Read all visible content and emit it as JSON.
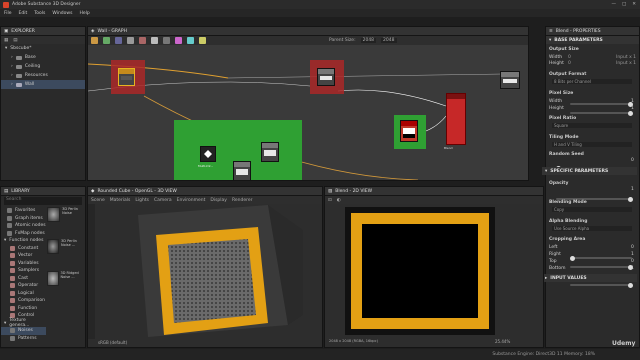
{
  "app": {
    "title": "Adobe Substance 3D Designer",
    "window_buttons": [
      "—",
      "□",
      "✕"
    ]
  },
  "menu": [
    "File",
    "Edit",
    "Tools",
    "Windows",
    "Help"
  ],
  "explorer": {
    "title": "EXPLORER",
    "root": "Sbscube*",
    "items": [
      "Base",
      "Ceiling",
      "Resources",
      "Wall"
    ],
    "selected": "Wall"
  },
  "graph": {
    "title": "Wall - GRAPH",
    "parent_size_label": "Parent Size:",
    "parent_size_w": "2048",
    "parent_size_h": "2048",
    "nodes": {
      "uniform": "Uniform Co...",
      "blend": "Blend",
      "shape": "Shape",
      "mask_label": "Multi-Dir..."
    }
  },
  "library": {
    "title": "LIBRARY",
    "search_placeholder": "Search",
    "tree": [
      "Favorites",
      "Graph items",
      "Atomic nodes",
      "FxMap nodes",
      "Function nodes",
      "Constant",
      "Vector",
      "Variables",
      "Samplers",
      "Cast",
      "Operator",
      "Logical",
      "Comparison",
      "Function",
      "Control",
      "Texture genera...",
      "Noises",
      "Patterns"
    ],
    "thumbs": [
      "3D Perlin Noise",
      "3D Perlin Noise ...",
      "3D Ridged Noise ..."
    ]
  },
  "view3d": {
    "title": "Rounded Cube - OpenGL - 3D VIEW",
    "menu": [
      "Scene",
      "Materials",
      "Lights",
      "Camera",
      "Environment",
      "Display",
      "Renderer"
    ],
    "status": "sRGB (default)"
  },
  "view2d": {
    "title": "Blend - 2D VIEW",
    "status": "2048 x 2048 (RGBA, 16bpc)",
    "zoom": "25.44%"
  },
  "properties": {
    "title": "Blend - PROPERTIES",
    "sections": {
      "base": "BASE PARAMETERS",
      "specific": "SPECIFIC PARAMETERS",
      "input": "INPUT VALUES"
    },
    "output_size": "Output Size",
    "width": "Width",
    "height": "Height",
    "relative": "Relative to parent",
    "w_val": "0",
    "h_val": "0",
    "input_1": "Input x 1",
    "output_format": "Output Format",
    "format_val": "8 Bits per Channel",
    "pixel_size": "Pixel Size",
    "px_w": "1",
    "px_h": "1",
    "pixel_ratio": "Pixel Ratio",
    "ratio_val": "Square",
    "tiling_mode": "Tiling Mode",
    "tiling_val": "H and V Tiling",
    "random_seed": "Random Seed",
    "seed_val": "0",
    "opacity": "Opacity",
    "opacity_val": "1",
    "blending_mode": "Blending Mode",
    "blending_val": "Copy",
    "alpha_blending": "Alpha Blending",
    "alpha_val": "Use Source Alpha",
    "cropping": "Cropping Area",
    "left": "Left",
    "right": "Right",
    "top": "Top",
    "bottom": "Bottom",
    "left_v": "0",
    "right_v": "1",
    "top_v": "0",
    "bottom_v": "1"
  },
  "statusbar": {
    "version": "Substance Engine: Direct3D 11  Memory: 18%"
  },
  "watermark": "Udemy"
}
